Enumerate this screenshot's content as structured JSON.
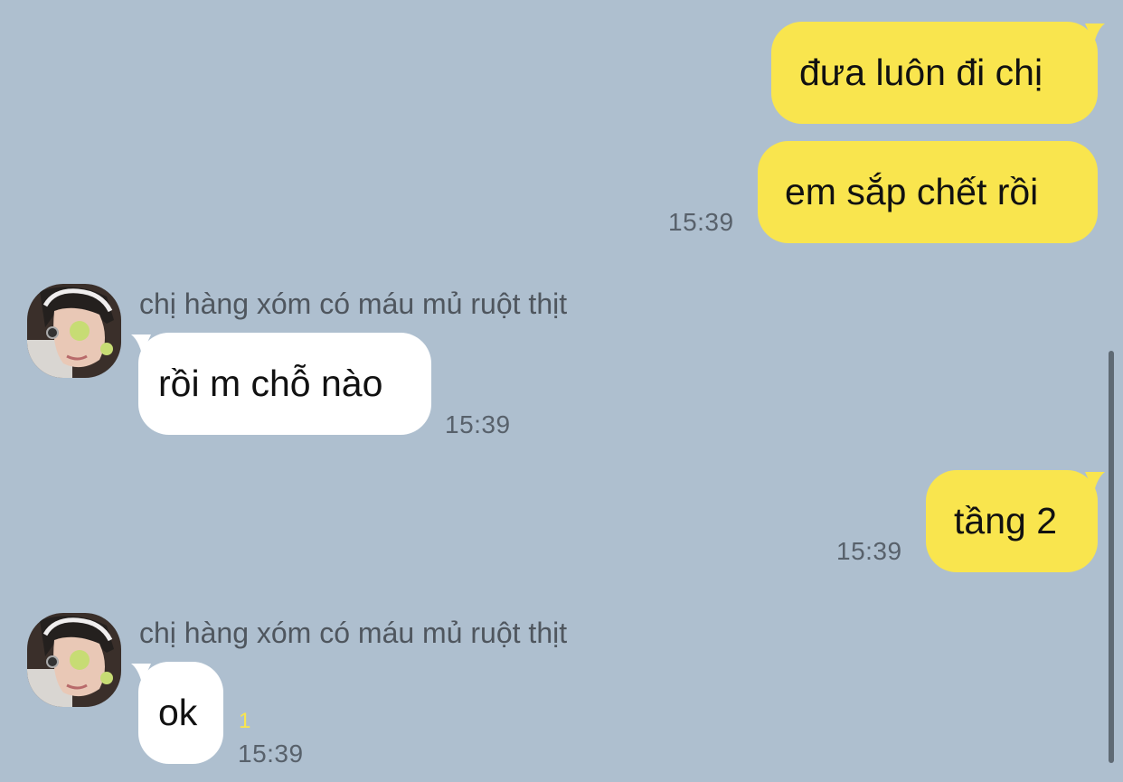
{
  "chat": {
    "contact_name": "chị hàng xóm có máu mủ ruột thịt",
    "messages": [
      {
        "from": "me",
        "text": "đưa luôn đi chị"
      },
      {
        "from": "me",
        "text": "em sắp chết rồi",
        "time": "15:39"
      },
      {
        "from": "them",
        "sender": "chị hàng xóm có máu mủ ruột thịt",
        "text": "rồi m chỗ nào",
        "time": "15:39"
      },
      {
        "from": "me",
        "text": "tầng 2",
        "time": "15:39"
      },
      {
        "from": "them",
        "sender": "chị hàng xóm có máu mủ ruột thịt",
        "text": "ok",
        "unread": "1",
        "time": "15:39"
      }
    ]
  },
  "colors": {
    "background": "#aebfcf",
    "my_bubble": "#f9e54e",
    "their_bubble": "#ffffff",
    "timestamp": "#58616b",
    "unread_count": "#f9e54e"
  },
  "icons": {
    "avatar": "contact-photo",
    "scrollbar": "vertical-scrollbar"
  }
}
